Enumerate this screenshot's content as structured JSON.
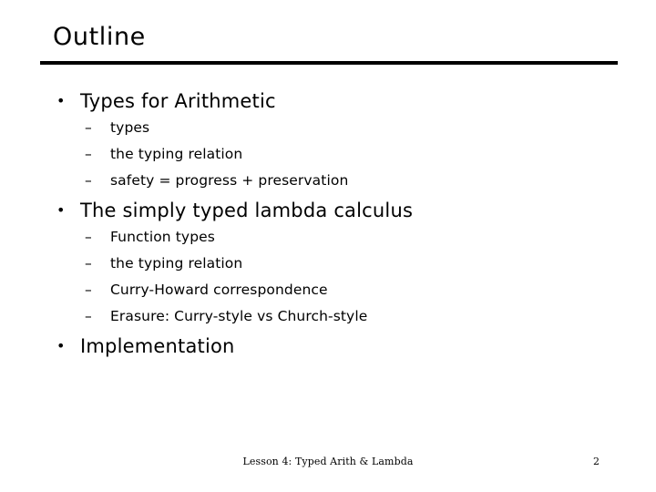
{
  "slide": {
    "title": "Outline",
    "bullet_marker": "•",
    "dash_marker": "–",
    "sections": [
      {
        "heading": "Types for Arithmetic",
        "items": [
          "types",
          "the typing relation",
          "safety = progress + preservation"
        ]
      },
      {
        "heading": "The simply typed lambda calculus",
        "items": [
          "Function types",
          "the typing relation",
          "Curry-Howard correspondence",
          "Erasure: Curry-style vs Church-style"
        ]
      },
      {
        "heading": "Implementation",
        "items": []
      }
    ]
  },
  "footer": {
    "center_text": "Lesson 4: Typed Arith & Lambda",
    "page_number": "2"
  },
  "colors": {
    "text": "#000000",
    "background": "#ffffff",
    "rule": "#000000"
  }
}
